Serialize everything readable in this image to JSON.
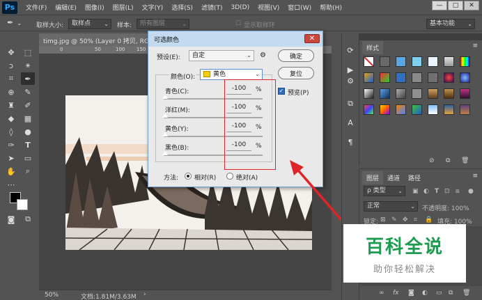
{
  "app": {
    "logo": "Ps"
  },
  "menu": [
    "文件(F)",
    "编辑(E)",
    "图像(I)",
    "图层(L)",
    "文字(Y)",
    "选择(S)",
    "滤镜(T)",
    "3D(D)",
    "视图(V)",
    "窗口(W)",
    "帮助(H)"
  ],
  "window_controls": {
    "minimize": "—",
    "maximize": "□",
    "close": "✕"
  },
  "options_bar": {
    "sample_size_label": "取样大小:",
    "sample_size_value": "取样点",
    "sample_label": "样本:",
    "sample_value": "所有图层",
    "show_ring_label": "显示取样环",
    "workspace_value": "基本功能"
  },
  "document": {
    "tab_title": "timg.jpg @ 50% (Layer 0 拷贝, RGB/8#)",
    "ruler_ticks": [
      "0",
      "50",
      "100",
      "150",
      "200"
    ],
    "zoom": "50%",
    "doc_info": "文档:1.81M/3.63M"
  },
  "dialog": {
    "title": "可选颜色",
    "close_label": "✕",
    "preset_label": "预设(E):",
    "preset_value": "自定",
    "ok_label": "确定",
    "reset_label": "复位",
    "colors_label": "颜色(O):",
    "colors_value": "黄色",
    "colors_swatch": "#f8d000",
    "preview_label": "预览(P)",
    "sliders": [
      {
        "label": "青色(C):",
        "value": "-100",
        "unit": "%"
      },
      {
        "label": "洋红(M):",
        "value": "-100",
        "unit": "%"
      },
      {
        "label": "黄色(Y):",
        "value": "-100",
        "unit": "%"
      },
      {
        "label": "黑色(B):",
        "value": "-100",
        "unit": "%"
      }
    ],
    "method_label": "方法:",
    "method_relative": "相对(R)",
    "method_absolute": "绝对(A)"
  },
  "styles_panel": {
    "tab": "样式"
  },
  "layers_panel": {
    "tabs": [
      "图层",
      "通道",
      "路径"
    ],
    "kind_filter": "ρ 类型",
    "blend_mode": "正常",
    "opacity_label": "不透明度: 100%",
    "lock_label": "锁定:",
    "fill_label": "填充: 100%"
  },
  "watermark": {
    "title": "百科全说",
    "subtitle": "助你轻松解决"
  },
  "colors": {
    "annotation_red": "#e0252a",
    "watermark_green": "#1c9c51",
    "dialog_title_bg": "#c4daf0"
  }
}
